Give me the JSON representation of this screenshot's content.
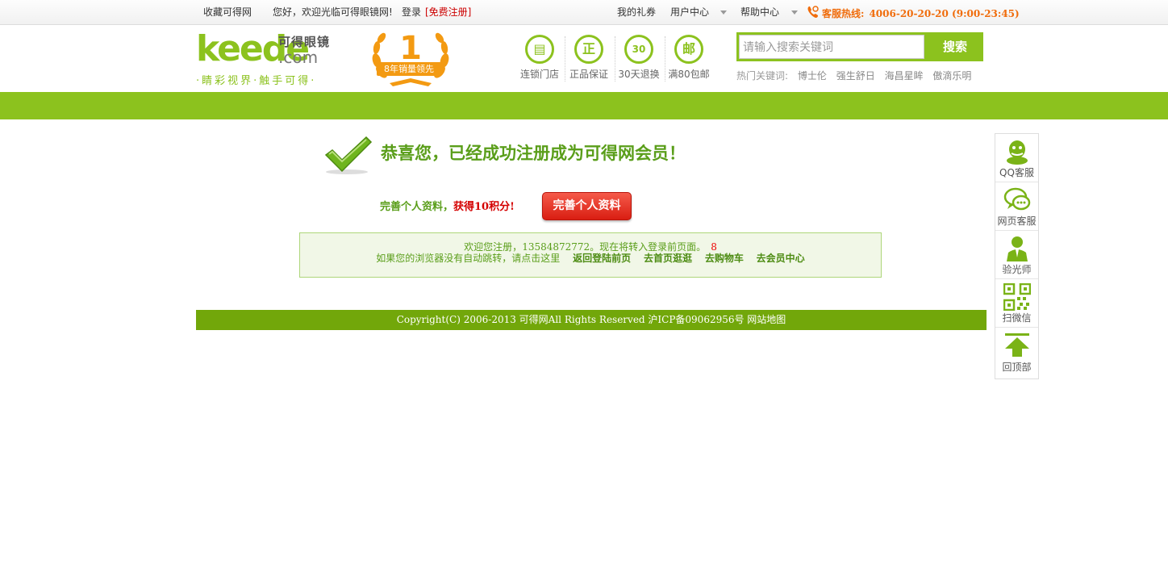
{
  "topbar": {
    "bookmark": "收藏可得网",
    "welcome": "您好，欢迎光临可得眼镜网!",
    "login": "登录",
    "register": "[免费注册]",
    "gifts": "我的礼券",
    "user_center": "用户中心",
    "help_center": "帮助中心",
    "hotline_label": "客服热线:",
    "hotline_number": "4006-20-20-20 (9:00-23:45)"
  },
  "header": {
    "logo_word": "keede",
    "logo_com": ".com",
    "logo_cn": "可得眼镜",
    "logo_slogan": "·睛彩视界·触手可得·",
    "badge_number": "1",
    "badge_text": "8年销量领先",
    "features": [
      {
        "icon": "store-icon",
        "glyph": "▤",
        "label": "连锁门店"
      },
      {
        "icon": "genuine-icon",
        "glyph": "正",
        "label": "正品保证"
      },
      {
        "icon": "return-30-icon",
        "glyph": "30",
        "label": "30天退换"
      },
      {
        "icon": "mail-icon",
        "glyph": "邮",
        "label": "满80包邮"
      }
    ]
  },
  "search": {
    "placeholder": "请输入搜索关键词",
    "button": "搜索",
    "hot_label": "热门关键词:",
    "hot_words": [
      "博士伦",
      "强生舒日",
      "海昌星眸",
      "傲滴乐明"
    ]
  },
  "success": {
    "title": "恭喜您，已经成功注册成为可得网会员！",
    "profile_prefix": "完善个人资料，",
    "profile_reward": "获得10积分!",
    "profile_button": "完善个人资料"
  },
  "notice": {
    "line1_prefix": "欢迎您注册，",
    "phone": "13584872772",
    "line1_suffix": "。现在将转入登录前页面。",
    "countdown": "8",
    "line2_prefix": "如果您的浏览器没有自动跳转，请点击这里",
    "links": [
      "返回登陆前页",
      "去首页逛逛",
      "去购物车",
      "去会员中心"
    ]
  },
  "footer": {
    "text": "Copyright(C) 2006-2013 可得网All Rights Reserved 沪ICP备09062956号 网站地图"
  },
  "sidebar": {
    "items": [
      {
        "icon": "qq-icon",
        "label": "QQ客服"
      },
      {
        "icon": "chat-icon",
        "label": "网页客服"
      },
      {
        "icon": "optometrist-icon",
        "label": "验光师"
      },
      {
        "icon": "qrcode-icon",
        "label": "扫微信"
      },
      {
        "icon": "back-to-top-icon",
        "label": "回顶部"
      }
    ]
  },
  "colors": {
    "brand_green": "#8cc21e",
    "footer_green": "#72a70a",
    "hotline_orange": "#f06c0b",
    "accent_red": "#d40000"
  }
}
